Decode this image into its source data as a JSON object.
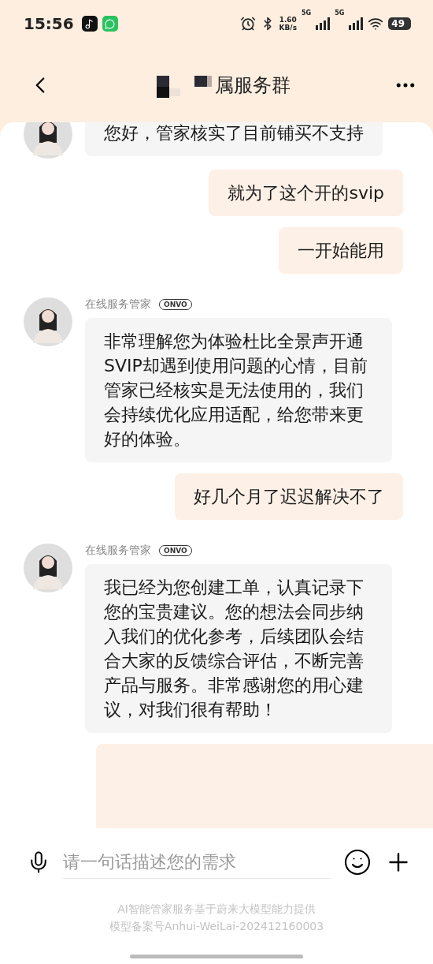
{
  "status_bar": {
    "time": "15:56",
    "speed": "1.60",
    "speed_unit": "KB/s",
    "networks": [
      "5G",
      "5G"
    ],
    "battery": "49"
  },
  "header": {
    "title": "属服务群"
  },
  "messages": [
    {
      "kind": "agent",
      "text": "您好，管家核实了目前铺买不支持"
    },
    {
      "kind": "user",
      "text": "就为了这个开的svip"
    },
    {
      "kind": "user",
      "text": "一开始能用"
    },
    {
      "kind": "agent",
      "name": "在线服务管家",
      "badge": "ONVO",
      "text": "非常理解您为体验杜比全景声开通SVIP却遇到使用问题的心情，目前管家已经核实是无法使用的，我们会持续优化应用适配，给您带来更好的体验。"
    },
    {
      "kind": "user",
      "text": "好几个月了迟迟解决不了"
    },
    {
      "kind": "agent",
      "name": "在线服务管家",
      "badge": "ONVO",
      "text": "我已经为您创建工单，认真记录下您的宝贵建议。您的想法会同步纳入我们的优化参考，后续团队会结合大家的反馈综合评估，不断完善产品与服务。非常感谢您的用心建议，对我们很有帮助！"
    },
    {
      "kind": "user"
    }
  ],
  "input": {
    "placeholder": "请一句话描述您的需求"
  },
  "footer": [
    "AI智能管家服务基于蔚来大模型能力提供",
    "模型备案号Anhui-WeiLai-202412160003"
  ]
}
